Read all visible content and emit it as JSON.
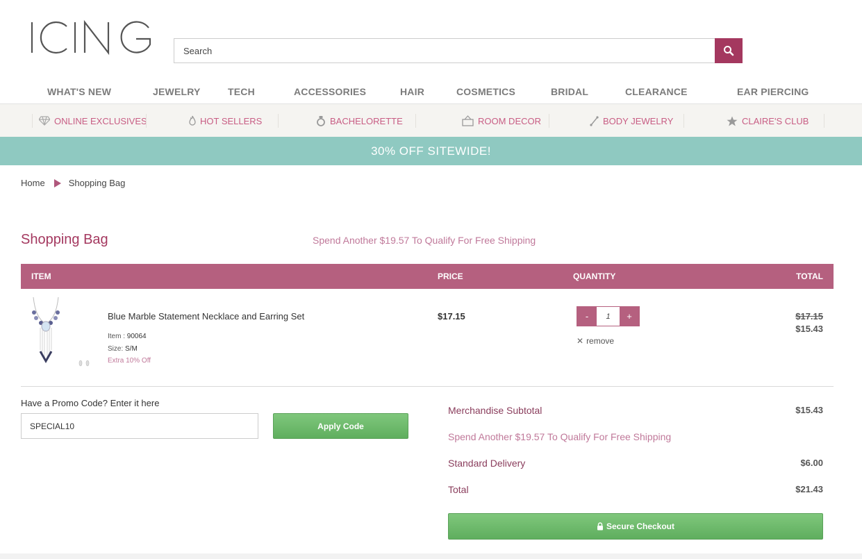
{
  "header": {
    "logo_text": "ICING",
    "search": {
      "placeholder": "Search",
      "value": ""
    }
  },
  "main_nav": [
    {
      "label": "WHAT'S NEW"
    },
    {
      "label": "JEWELRY"
    },
    {
      "label": "TECH"
    },
    {
      "label": "ACCESSORIES"
    },
    {
      "label": "HAIR"
    },
    {
      "label": "COSMETICS"
    },
    {
      "label": "BRIDAL"
    },
    {
      "label": "CLEARANCE"
    },
    {
      "label": "EAR PIERCING"
    }
  ],
  "sub_nav": [
    {
      "label": "ONLINE EXCLUSIVES",
      "icon": "diamond-icon"
    },
    {
      "label": "HOT SELLERS",
      "icon": "flame-icon"
    },
    {
      "label": "BACHELORETTE",
      "icon": "ring-icon"
    },
    {
      "label": "ROOM DECOR",
      "icon": "frame-icon"
    },
    {
      "label": "BODY JEWELRY",
      "icon": "pin-icon"
    },
    {
      "label": "CLAIRE'S CLUB",
      "icon": "star-icon"
    }
  ],
  "promo_banner": "30% OFF SITEWIDE!",
  "breadcrumb": {
    "home": "Home",
    "current": "Shopping Bag"
  },
  "bag": {
    "title": "Shopping Bag",
    "shipping_message": "Spend Another $19.57 To Qualify For Free Shipping",
    "columns": {
      "item": "ITEM",
      "price": "PRICE",
      "quantity": "QUANTITY",
      "total": "TOTAL"
    },
    "items": [
      {
        "name": "Blue Marble Statement Necklace and Earring Set",
        "item_label": "Item : ",
        "item_number": "90064",
        "size_label": "Size: ",
        "size": "S/M",
        "discount": "Extra 10% Off",
        "price": "$17.15",
        "quantity": "1",
        "minus": "-",
        "plus": "+",
        "remove": "remove",
        "total_original": "$17.15",
        "total": "$15.43"
      }
    ]
  },
  "promo": {
    "label": "Have a Promo Code? Enter it here",
    "value": "SPECIAL10",
    "apply": "Apply Code"
  },
  "summary": {
    "subtotal_label": "Merchandise Subtotal",
    "subtotal": "$15.43",
    "shipping_message": "Spend Another $19.57 To Qualify For Free Shipping",
    "delivery_label": "Standard Delivery",
    "delivery": "$6.00",
    "total_label": "Total",
    "total": "$21.43",
    "checkout": "Secure Checkout"
  },
  "colors": {
    "brand": "#a4385f",
    "table_header": "#b5607f",
    "banner": "#8fc9c1",
    "accent_pink": "#c85d84",
    "button_green": "#6bb96a"
  }
}
